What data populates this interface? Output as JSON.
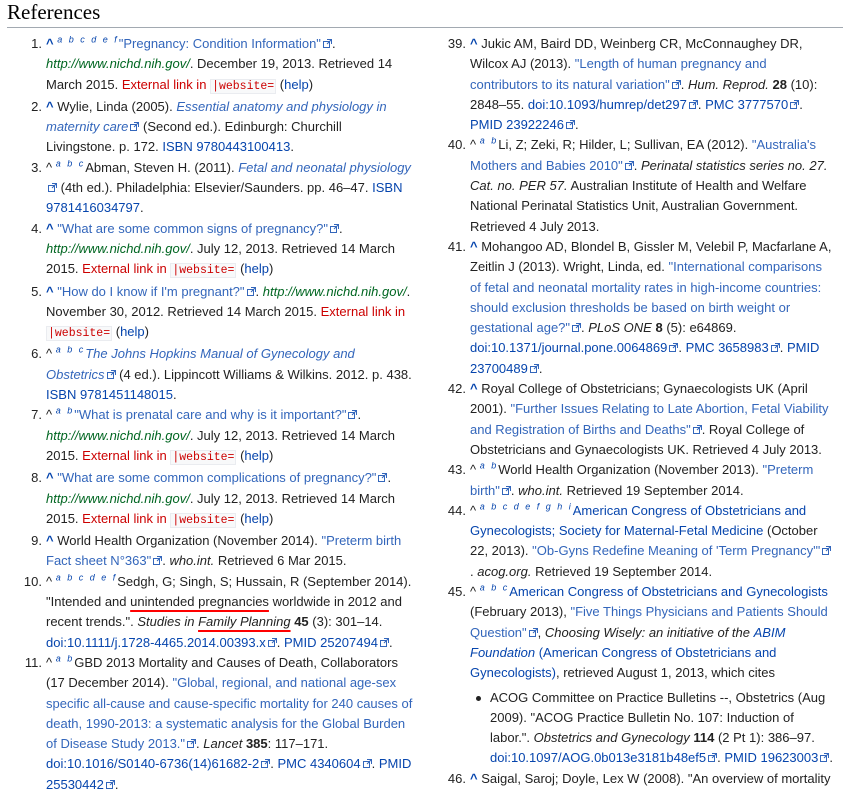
{
  "heading": "References",
  "links": {
    "external_link_error": "External link in",
    "website_param": "|website=",
    "help": "help"
  },
  "refs": [
    {
      "n": "1.",
      "backlinks": "a b c d e f",
      "title": "\"Pregnancy: Condition Information\"",
      "site": "http://www.nichd.nih.gov/",
      "rest": ". December 19, 2013. Retrieved 14 March 2015."
    },
    {
      "n": "2.",
      "author": "Wylie, Linda (2005).",
      "book": "Essential anatomy and physiology in maternity care",
      "rest": "(Second ed.). Edinburgh: Churchill Livingstone. p. 172.",
      "isbn": "ISBN 9780443100413"
    },
    {
      "n": "3.",
      "backlinks": "a b c",
      "author": "Abman, Steven H. (2011).",
      "book": "Fetal and neonatal physiology",
      "rest": "(4th ed.). Philadelphia: Elsevier/Saunders. pp. 46–47.",
      "isbn": "ISBN 9781416034797"
    },
    {
      "n": "4.",
      "title": "\"What are some common signs of pregnancy?\"",
      "site": "http://www.nichd.nih.gov/",
      "rest": ". July 12, 2013. Retrieved 14 March 2015."
    },
    {
      "n": "5.",
      "title": "\"How do I know if I'm pregnant?\"",
      "site": "http://www.nichd.nih.gov/",
      "rest": ". November 30, 2012. Retrieved 14 March 2015."
    },
    {
      "n": "6.",
      "backlinks": "a b c",
      "book": "The Johns Hopkins Manual of Gynecology and Obstetrics",
      "rest": "(4 ed.). Lippincott Williams & Wilkins. 2012. p. 438.",
      "isbn": "ISBN 9781451148015"
    },
    {
      "n": "7.",
      "backlinks": "a b",
      "title": "\"What is prenatal care and why is it important?\"",
      "site": "http://www.nichd.nih.gov/",
      "rest": ". July 12, 2013. Retrieved 14 March 2015."
    },
    {
      "n": "8.",
      "title": "\"What are some common complications of pregnancy?\"",
      "site": "http://www.nichd.nih.gov/",
      "rest": ". July 12, 2013. Retrieved 14 March 2015."
    },
    {
      "n": "9.",
      "author": "World Health Organization (November 2014).",
      "title": "\"Preterm birth Fact sheet N°363\"",
      "rest_i": "who.int.",
      "rest": "Retrieved 6 Mar 2015."
    },
    {
      "n": "10.",
      "backlinks": "a b c d e f",
      "author": "Sedgh, G; Singh, S; Hussain, R (September 2014).",
      "quote_a": "\"Intended and",
      "quote_u": "unintended pregnancies",
      "quote_b": "worldwide in 2012 and recent trends.\".",
      "journal_a": "Studies in",
      "journal_u": "Family Planning",
      "vol": "45",
      "rest": "(3): 301–14.",
      "doi": "doi:10.1111/j.1728-4465.2014.00393.x",
      "pmid": "PMID 25207494"
    },
    {
      "n": "11.",
      "backlinks": "a b",
      "author": "GBD 2013 Mortality and Causes of Death, Collaborators (17 December 2014).",
      "title": "\"Global, regional, and national age-sex specific all-cause and cause-specific mortality for 240 causes of death, 1990-2013: a systematic analysis for the Global Burden of Disease Study 2013.\"",
      "journal": "Lancet",
      "vol": "385",
      "rest": ": 117–171.",
      "doi": "doi:10.1016/S0140-6736(14)61682-2",
      "pmc": "PMC 4340604",
      "pmid": "PMID 25530442"
    },
    {
      "n": "39.",
      "author": "Jukic AM, Baird DD, Weinberg CR, McConnaughey DR, Wilcox AJ (2013).",
      "title": "\"Length of human pregnancy and contributors to its natural variation\"",
      "journal": "Hum. Reprod.",
      "vol": "28",
      "rest": "(10): 2848–55.",
      "doi": "doi:10.1093/humrep/det297",
      "pmc": "PMC 3777570",
      "pmid": "PMID 23922246"
    },
    {
      "n": "40.",
      "backlinks": "a b",
      "author": "Li, Z; Zeki, R; Hilder, L; Sullivan, EA (2012).",
      "title": "\"Australia's Mothers and Babies 2010\"",
      "journal": "Perinatal statistics series no. 27. Cat. no. PER 57.",
      "rest": "Australian Institute of Health and Welfare National Perinatal Statistics Unit, Australian Government. Retrieved 4 July 2013."
    },
    {
      "n": "41.",
      "author": "Mohangoo AD, Blondel B, Gissler M, Velebil P, Macfarlane A, Zeitlin J (2013). Wright, Linda, ed.",
      "title": "\"International comparisons of fetal and neonatal mortality rates in high-income countries: should exclusion thresholds be based on birth weight or gestational age?\"",
      "journal": "PLoS ONE",
      "vol": "8",
      "rest": "(5): e64869.",
      "doi": "doi:10.1371/journal.pone.0064869",
      "pmc": "PMC 3658983",
      "pmid": "PMID 23700489"
    },
    {
      "n": "42.",
      "author": "Royal College of Obstetricians; Gynaecologists UK (April 2001).",
      "title": "\"Further Issues Relating to Late Abortion, Fetal Viability and Registration of Births and Deaths\"",
      "rest": ". Royal College of Obstetricians and Gynaecologists UK. Retrieved 4 July 2013."
    },
    {
      "n": "43.",
      "backlinks": "a b",
      "author": "World Health Organization (November 2013).",
      "title": "\"Preterm birth\"",
      "rest_i": "who.int.",
      "rest": "Retrieved 19 September 2014."
    },
    {
      "n": "44.",
      "backlinks": "a b c d e f g h i",
      "author_link": "American Congress of Obstetricians and Gynecologists; Society for Maternal-Fetal Medicine",
      "author_rest": "(October 22, 2013).",
      "title": "\"Ob-Gyns Redefine Meaning of 'Term Pregnancy'\"",
      "rest_i": "acog.org.",
      "rest": "Retrieved 19 September 2014."
    },
    {
      "n": "45.",
      "backlinks": "a b c",
      "author_link": "American Congress of Obstetricians and Gynecologists",
      "author_rest": "(February 2013),",
      "title": "\"Five Things Physicians and Patients Should Question\"",
      "pub_i_a": "Choosing Wisely: an initiative of the",
      "pub_link": "ABIM Foundation",
      "pub_paren": "(American Congress of Obstetricians and Gynecologists)",
      "rest": ", retrieved August 1, 2013, which cites",
      "sub_author": "ACOG Committee on Practice Bulletins --, Obstetrics (Aug 2009).",
      "sub_title": "\"ACOG Practice Bulletin No. 107: Induction of labor.\".",
      "sub_journal": "Obstetrics and Gynecology",
      "sub_vol": "114",
      "sub_rest": "(2 Pt 1): 386–97.",
      "sub_doi": "doi:10.1097/AOG.0b013e3181b48ef5",
      "sub_pmid": "PMID 19623003"
    },
    {
      "n": "46.",
      "author": "Saigal, Saroj; Doyle, Lex W (2008). \"An overview of mortality"
    }
  ]
}
